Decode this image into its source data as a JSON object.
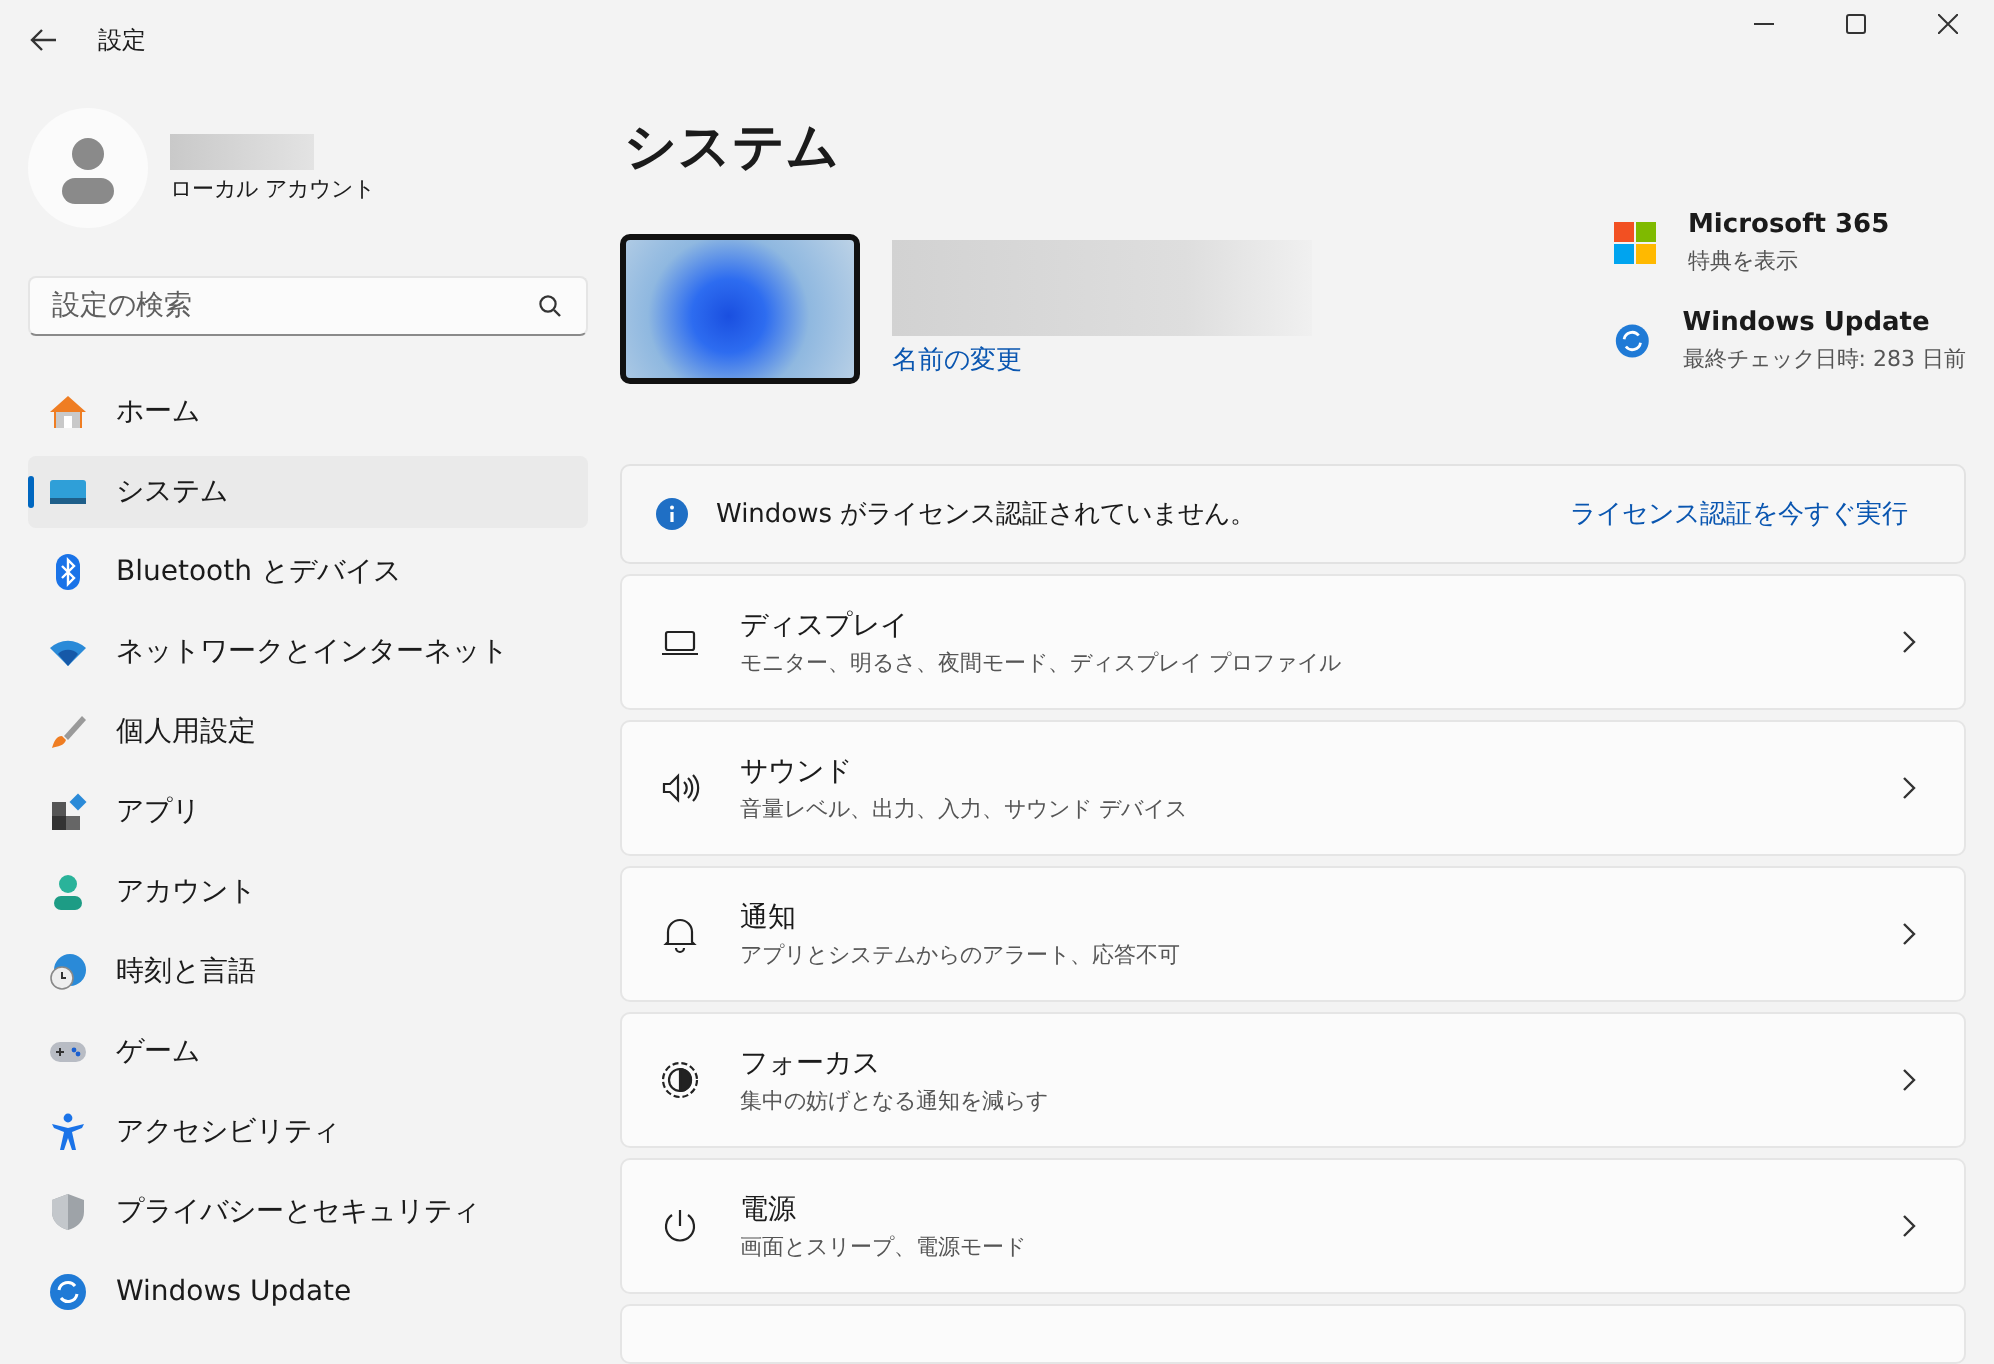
{
  "window": {
    "title": "設定"
  },
  "profile": {
    "account_type": "ローカル アカウント"
  },
  "search": {
    "placeholder": "設定の検索"
  },
  "nav": [
    {
      "label": "ホーム",
      "selected": false
    },
    {
      "label": "システム",
      "selected": true
    },
    {
      "label": "Bluetooth とデバイス",
      "selected": false
    },
    {
      "label": "ネットワークとインターネット",
      "selected": false
    },
    {
      "label": "個人用設定",
      "selected": false
    },
    {
      "label": "アプリ",
      "selected": false
    },
    {
      "label": "アカウント",
      "selected": false
    },
    {
      "label": "時刻と言語",
      "selected": false
    },
    {
      "label": "ゲーム",
      "selected": false
    },
    {
      "label": "アクセシビリティ",
      "selected": false
    },
    {
      "label": "プライバシーとセキュリティ",
      "selected": false
    },
    {
      "label": "Windows Update",
      "selected": false
    }
  ],
  "page_title": "システム",
  "device": {
    "rename_link": "名前の変更"
  },
  "quick_links": [
    {
      "title": "Microsoft 365",
      "subtitle": "特典を表示"
    },
    {
      "title": "Windows Update",
      "subtitle": "最終チェック日時: 283 日前"
    }
  ],
  "notice": {
    "text": "Windows がライセンス認証されていません。",
    "action": "ライセンス認証を今すぐ実行"
  },
  "settings": [
    {
      "title": "ディスプレイ",
      "subtitle": "モニター、明るさ、夜間モード、ディスプレイ プロファイル"
    },
    {
      "title": "サウンド",
      "subtitle": "音量レベル、出力、入力、サウンド デバイス"
    },
    {
      "title": "通知",
      "subtitle": "アプリとシステムからのアラート、応答不可"
    },
    {
      "title": "フォーカス",
      "subtitle": "集中の妨げとなる通知を減らす"
    },
    {
      "title": "電源",
      "subtitle": "画面とスリープ、電源モード"
    }
  ]
}
